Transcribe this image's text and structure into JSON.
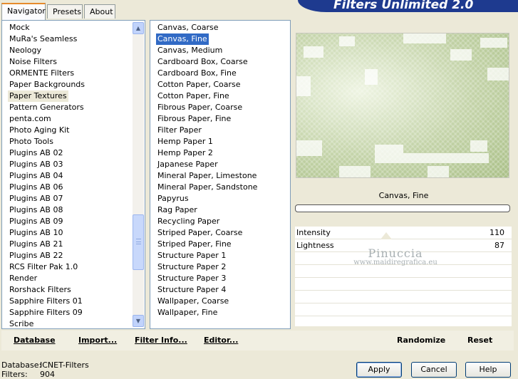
{
  "tabs": {
    "navigator": "Navigator",
    "presets": "Presets",
    "about": "About"
  },
  "banner": {
    "title": "Filters Unlimited 2.0"
  },
  "categories": {
    "items": [
      "Mock",
      "MuRa's Seamless",
      "Neology",
      "Noise Filters",
      "ORMENTE Filters",
      "Paper Backgrounds",
      "Paper Textures",
      "Pattern Generators",
      "penta.com",
      "Photo Aging Kit",
      "Photo Tools",
      "Plugins AB 02",
      "Plugins AB 03",
      "Plugins AB 04",
      "Plugins AB 06",
      "Plugins AB 07",
      "Plugins AB 08",
      "Plugins AB 09",
      "Plugins AB 10",
      "Plugins AB 21",
      "Plugins AB 22",
      "RCS Filter Pak 1.0",
      "Render",
      "Rorshack Filters",
      "Sapphire Filters 01",
      "Sapphire Filters 09",
      "Scribe"
    ],
    "selected": "Paper Textures"
  },
  "filters": {
    "items": [
      "Canvas, Coarse",
      "Canvas, Fine",
      "Canvas, Medium",
      "Cardboard Box, Coarse",
      "Cardboard Box, Fine",
      "Cotton Paper, Coarse",
      "Cotton Paper, Fine",
      "Fibrous Paper, Coarse",
      "Fibrous Paper, Fine",
      "Filter Paper",
      "Hemp Paper 1",
      "Hemp Paper 2",
      "Japanese Paper",
      "Mineral Paper, Limestone",
      "Mineral Paper, Sandstone",
      "Papyrus",
      "Rag Paper",
      "Recycling Paper",
      "Striped Paper, Coarse",
      "Striped Paper, Fine",
      "Structure Paper 1",
      "Structure Paper 2",
      "Structure Paper 3",
      "Structure Paper 4",
      "Wallpaper, Coarse",
      "Wallpaper, Fine"
    ],
    "selected": "Canvas, Fine"
  },
  "preview": {
    "filter_name": "Canvas, Fine"
  },
  "parameters": [
    {
      "label": "Intensity",
      "value": "110"
    },
    {
      "label": "Lightness",
      "value": "87"
    }
  ],
  "watermark": {
    "name": "Pinuccia",
    "url": "www.maidiregrafica.eu"
  },
  "bottom_bar": {
    "database": "Database",
    "import": "Import...",
    "filter_info": "Filter Info...",
    "editor": "Editor...",
    "randomize": "Randomize",
    "reset": "Reset"
  },
  "status": {
    "database_label": "Database:",
    "database_value": "ICNET-Filters",
    "filters_label": "Filters:",
    "filters_value": "904"
  },
  "dialog_buttons": {
    "apply": "Apply",
    "cancel": "Cancel",
    "help": "Help"
  }
}
